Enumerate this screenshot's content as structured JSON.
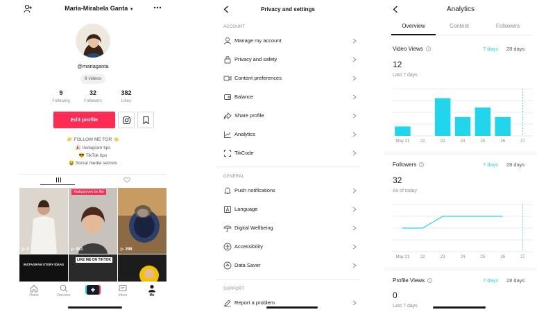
{
  "profile": {
    "username": "Maria-Mirabela Ganta",
    "handle": "@mariaganta",
    "videos_pill": "8 videos",
    "stats": [
      {
        "value": "9",
        "label": "Following"
      },
      {
        "value": "32",
        "label": "Followers"
      },
      {
        "value": "382",
        "label": "Likes"
      }
    ],
    "edit_label": "Edit profile",
    "bio": [
      "👉 FOLLOW ME FOR 👈",
      "🎉 Instagram tips",
      "😎 TikTok tips",
      "🤑 Social media secrets"
    ],
    "videos": [
      {
        "views": "0",
        "caption": ""
      },
      {
        "views": "951",
        "caption": "#askgaryvee be like"
      },
      {
        "views": "298",
        "caption": ""
      },
      {
        "views": "",
        "caption": "INSTAGRAM STORY IDEAS"
      },
      {
        "views": "",
        "caption": "LIKE ME ON TIKTOK"
      },
      {
        "views": "",
        "caption": ""
      }
    ],
    "nav": [
      "Home",
      "Discover",
      "",
      "Inbox",
      "Me"
    ]
  },
  "settings": {
    "title": "Privacy and settings",
    "sections": [
      {
        "header": "ACCOUNT",
        "items": [
          {
            "icon": "person-icon",
            "label": "Manage my account"
          },
          {
            "icon": "lock-icon",
            "label": "Privacy and safety"
          },
          {
            "icon": "video-icon",
            "label": "Content preferences"
          },
          {
            "icon": "wallet-icon",
            "label": "Balance"
          },
          {
            "icon": "share-icon",
            "label": "Share profile"
          },
          {
            "icon": "analytics-icon",
            "label": "Analytics"
          },
          {
            "icon": "tikcode-icon",
            "label": "TikCode"
          }
        ]
      },
      {
        "header": "GENERAL",
        "items": [
          {
            "icon": "bell-icon",
            "label": "Push notifications"
          },
          {
            "icon": "language-icon",
            "label": "Language"
          },
          {
            "icon": "umbrella-icon",
            "label": "Digital Wellbeing"
          },
          {
            "icon": "accessibility-icon",
            "label": "Accessibility"
          },
          {
            "icon": "datasaver-icon",
            "label": "Data Saver"
          }
        ]
      },
      {
        "header": "SUPPORT",
        "items": [
          {
            "icon": "pencil-icon",
            "label": "Report a problem"
          }
        ]
      }
    ]
  },
  "analytics": {
    "title": "Analytics",
    "tabs": [
      "Overview",
      "Content",
      "Followers"
    ],
    "ranges": [
      "7 days",
      "28 days"
    ],
    "video_views": {
      "title": "Video Views",
      "value": "12",
      "sub": "Last 7 days",
      "x_labels": [
        "May 21",
        "22",
        "23",
        "24",
        "25",
        "26",
        "27"
      ]
    },
    "followers": {
      "title": "Followers",
      "value": "32",
      "sub": "As of today",
      "x_labels": [
        "May 21",
        "22",
        "23",
        "24",
        "25",
        "26",
        "27"
      ]
    },
    "profile_views": {
      "title": "Profile Views",
      "value": "0",
      "sub": "Last 7 days"
    }
  },
  "chart_data": [
    {
      "type": "bar",
      "categories": [
        "May 21",
        "22",
        "23",
        "24",
        "25",
        "26",
        "27"
      ],
      "values": [
        1,
        0,
        4,
        2,
        3,
        2,
        0
      ],
      "ylim": [
        0,
        5
      ],
      "color": "#20d5ec"
    },
    {
      "type": "line",
      "categories": [
        "May 21",
        "22",
        "23",
        "24",
        "25",
        "26"
      ],
      "values": [
        31,
        31,
        32,
        32,
        32,
        32
      ],
      "ylim": [
        29,
        33
      ],
      "color": "#20d5ec"
    }
  ],
  "colors": {
    "accent": "#fe2c55",
    "chart": "#20d5ec"
  }
}
